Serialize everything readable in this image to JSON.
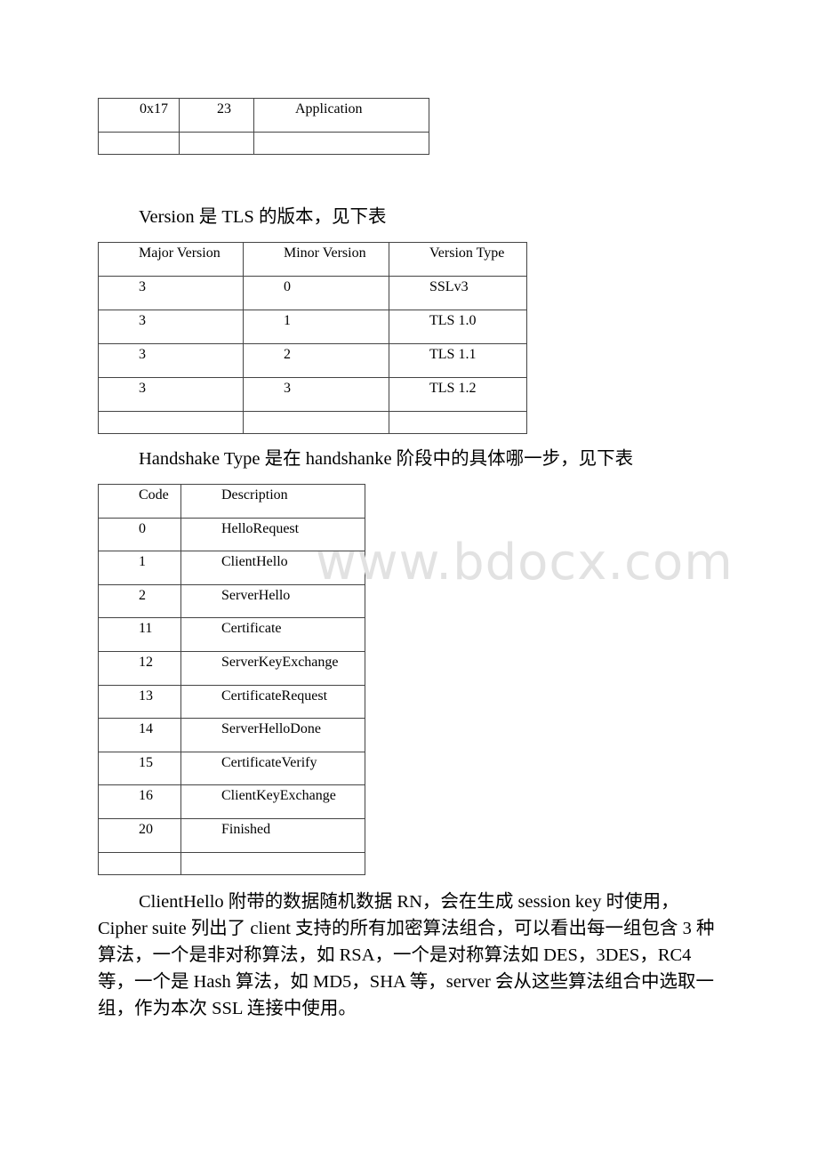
{
  "table_content_type": {
    "rows": [
      [
        "0x17",
        "23",
        "Application"
      ],
      [
        "",
        "",
        ""
      ]
    ]
  },
  "paragraph_version": "Version 是 TLS 的版本，见下表",
  "table_version": {
    "headers": [
      "Major Version",
      "Minor Version",
      "Version Type"
    ],
    "rows": [
      [
        "3",
        "0",
        "SSLv3"
      ],
      [
        "3",
        "1",
        "TLS 1.0"
      ],
      [
        "3",
        "2",
        "TLS 1.1"
      ],
      [
        "3",
        "3",
        "TLS 1.2"
      ],
      [
        "",
        "",
        ""
      ]
    ]
  },
  "paragraph_handshake": "Handshake Type 是在 handshanke 阶段中的具体哪一步，见下表",
  "table_handshake": {
    "headers": [
      "Code",
      "Description"
    ],
    "rows": [
      [
        "0",
        "HelloRequest"
      ],
      [
        "1",
        "ClientHello"
      ],
      [
        "2",
        "ServerHello"
      ],
      [
        "11",
        "Certificate"
      ],
      [
        "12",
        "ServerKeyExchange"
      ],
      [
        "13",
        "CertificateRequest"
      ],
      [
        "14",
        "ServerHelloDone"
      ],
      [
        "15",
        "CertificateVerify"
      ],
      [
        "16",
        "ClientKeyExchange"
      ],
      [
        "20",
        "Finished"
      ],
      [
        "",
        ""
      ]
    ]
  },
  "paragraph_clienthello": "ClientHello 附带的数据随机数据 RN，会在生成 session key 时使用，Cipher suite 列出了 client 支持的所有加密算法组合，可以看出每一组包含 3 种算法，一个是非对称算法，如 RSA，一个是对称算法如 DES，3DES，RC4 等，一个是 Hash 算法，如 MD5，SHA 等，server 会从这些算法组合中选取一组，作为本次 SSL 连接中使用。",
  "watermark": "www.bdocx.com"
}
